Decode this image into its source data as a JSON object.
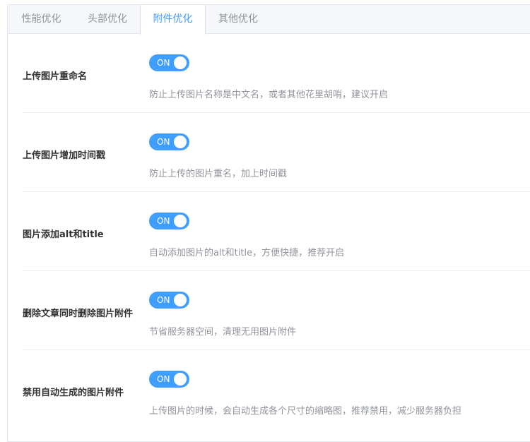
{
  "tabs": [
    {
      "label": "性能优化"
    },
    {
      "label": "头部优化"
    },
    {
      "label": "附件优化"
    },
    {
      "label": "其他优化"
    }
  ],
  "active_tab": "附件优化",
  "accent_color": "#409eff",
  "settings": [
    {
      "label": "上传图片重命名",
      "switch_text": "ON",
      "enabled": true,
      "description": "防止上传图片名称是中文名，或者其他花里胡哨，建议开启"
    },
    {
      "label": "上传图片增加时间戳",
      "switch_text": "ON",
      "enabled": true,
      "description": "防止上传的图片重名，加上时间戳"
    },
    {
      "label": "图片添加alt和title",
      "switch_text": "ON",
      "enabled": true,
      "description": "自动添加图片的alt和title，方便快捷，推荐开启"
    },
    {
      "label": "删除文章同时删除图片附件",
      "switch_text": "ON",
      "enabled": true,
      "description": "节省服务器空间，清理无用图片附件"
    },
    {
      "label": "禁用自动生成的图片附件",
      "switch_text": "ON",
      "enabled": true,
      "description": "上传图片的时候，会自动生成各个尺寸的缩略图，推荐禁用，减少服务器负担"
    }
  ]
}
